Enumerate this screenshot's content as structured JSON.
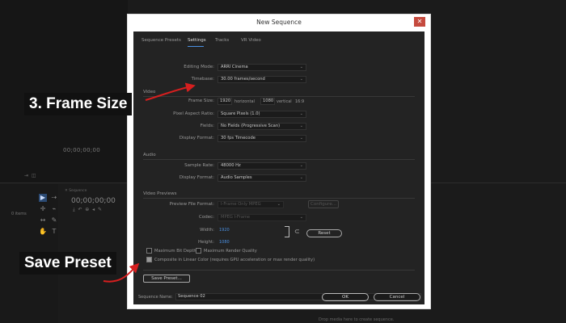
{
  "background": {
    "program_timecode": "00;00;00;00",
    "sequence_timecode": "00;00;00;00",
    "project_items": "0 items",
    "sequence_tab": "✕ Sequence",
    "drop_hint": "Drop media here to create sequence."
  },
  "dialog": {
    "title": "New Sequence",
    "close_label": "✕",
    "tabs": [
      "Sequence Presets",
      "Settings",
      "Tracks",
      "VR Video"
    ],
    "active_tab": "Settings",
    "editing_mode_label": "Editing Mode:",
    "editing_mode_value": "ARRI Cinema",
    "timebase_label": "Timebase:",
    "timebase_value": "30.00  frames/second",
    "video_section": "Video",
    "frame_size_label": "Frame Size:",
    "frame_width": "1920",
    "horizontal_label": "horizontal",
    "frame_height": "1080",
    "vertical_label": "vertical",
    "aspect": "16:9",
    "pixel_aspect_label": "Pixel Aspect Ratio:",
    "pixel_aspect_value": "Square Pixels (1.0)",
    "fields_label": "Fields:",
    "fields_value": "No Fields (Progressive Scan)",
    "display_format_label": "Display Format:",
    "display_format_value": "30 fps Timecode",
    "audio_section": "Audio",
    "sample_rate_label": "Sample Rate:",
    "sample_rate_value": "48000 Hz",
    "audio_display_label": "Display Format:",
    "audio_display_value": "Audio Samples",
    "preview_section": "Video Previews",
    "preview_format_label": "Preview File Format:",
    "preview_format_value": "I-Frame Only MPEG",
    "configure_label": "Configure...",
    "codec_label": "Codec:",
    "codec_value": "MPEG I-Frame",
    "width_label": "Width:",
    "width_value": "1920",
    "height_label": "Height:",
    "height_value": "1080",
    "reset_label": "Reset",
    "max_bit_depth_label": "Maximum Bit Depth",
    "max_render_quality_label": "Maximum Render Quality",
    "composite_label": "Composite in Linear Color (requires GPU acceleration or max render quality)",
    "save_preset_label": "Save Preset...",
    "sequence_name_label": "Sequence Name:",
    "sequence_name_value": "Sequence 02",
    "ok_label": "OK",
    "cancel_label": "Cancel"
  },
  "annotations": {
    "frame_size": "3. Frame Size",
    "save_preset": "Save Preset",
    "arrow_color": "#d61f1f"
  }
}
